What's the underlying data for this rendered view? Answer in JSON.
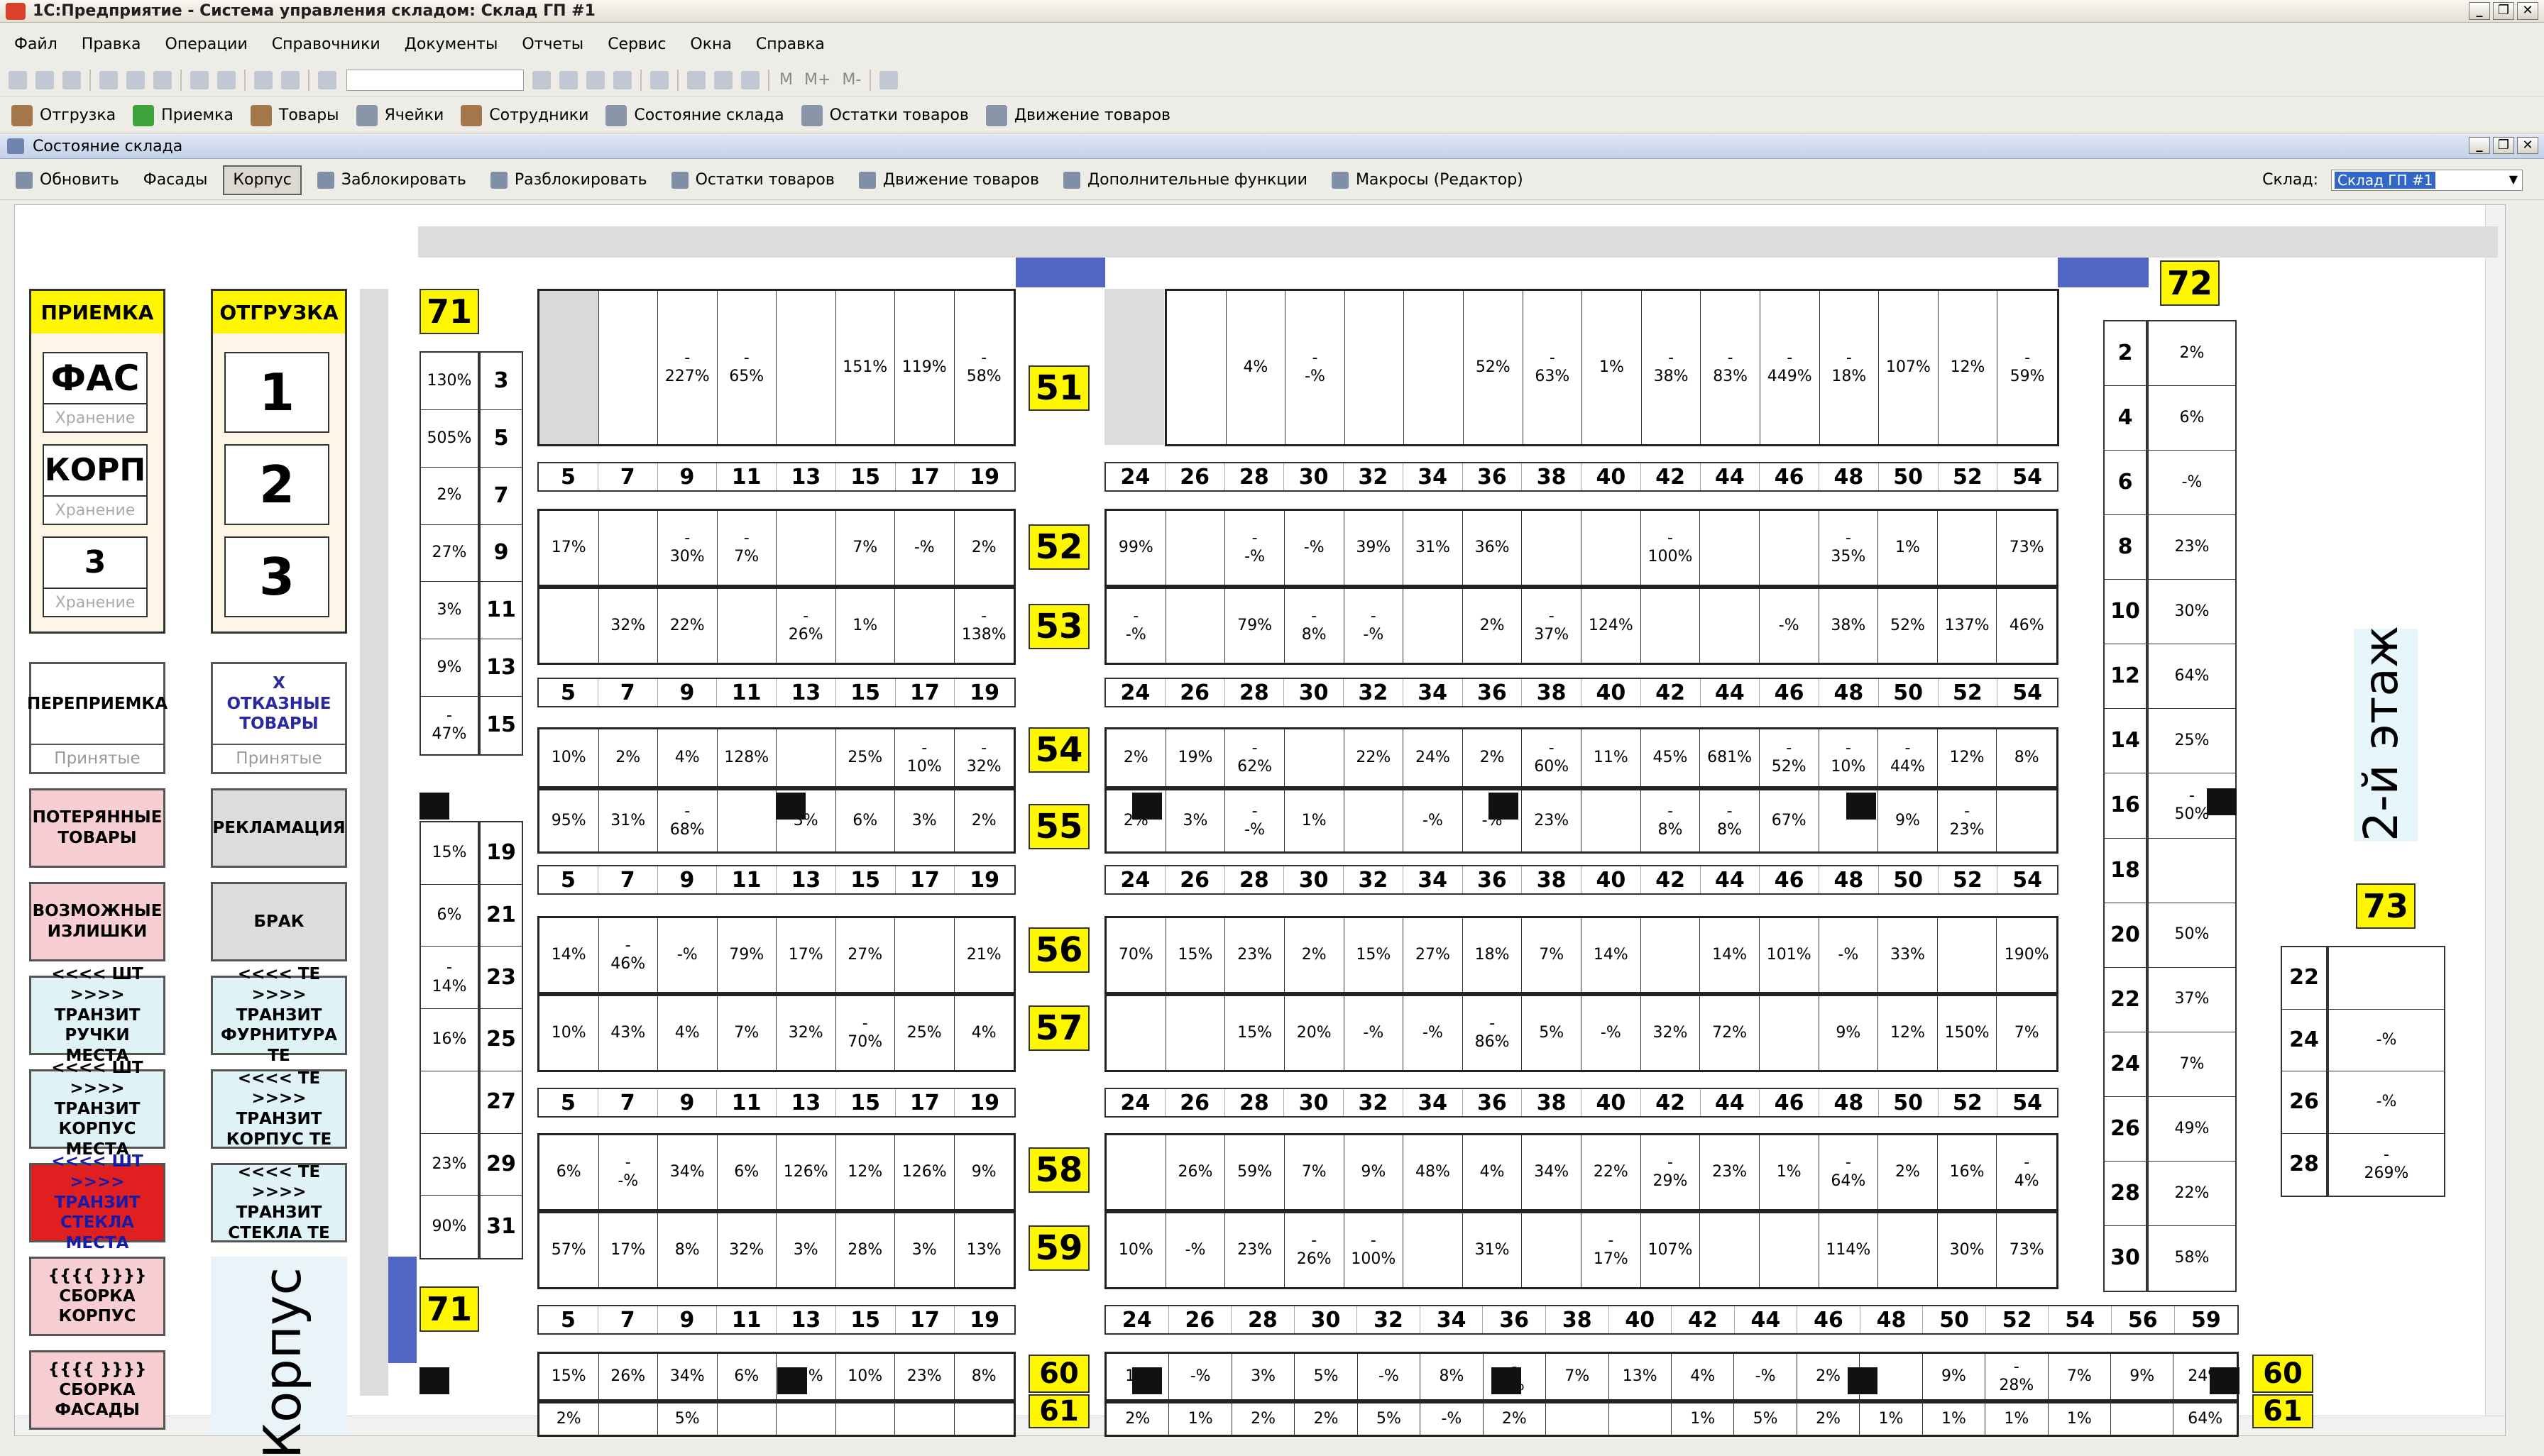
{
  "window": {
    "title": "1С:Предприятие - Система управления складом: Склад ГП #1"
  },
  "menu": [
    "Файл",
    "Правка",
    "Операции",
    "Справочники",
    "Документы",
    "Отчеты",
    "Сервис",
    "Окна",
    "Справка"
  ],
  "toolbar": {
    "m1": "M",
    "m2": "M+",
    "m3": "M-"
  },
  "shortcuts": [
    {
      "label": "Отгрузка",
      "icon": "truck-icon"
    },
    {
      "label": "Приемка",
      "icon": "checkmark-icon"
    },
    {
      "label": "Товары",
      "icon": "goods-icon"
    },
    {
      "label": "Ячейки",
      "icon": "cells-icon"
    },
    {
      "label": "Сотрудники",
      "icon": "users-icon"
    },
    {
      "label": "Состояние склада",
      "icon": "warehouse-state-icon"
    },
    {
      "label": "Остатки товаров",
      "icon": "stock-icon"
    },
    {
      "label": "Движение товаров",
      "icon": "movement-icon"
    }
  ],
  "form": {
    "title": "Состояние склада",
    "buttons": [
      {
        "label": "Обновить",
        "icon": "refresh-icon"
      },
      {
        "label": "Фасады",
        "icon": ""
      },
      {
        "label": "Корпус",
        "icon": "",
        "pressed": true
      },
      {
        "label": "Заблокировать",
        "icon": "lock-icon"
      },
      {
        "label": "Разблокировать",
        "icon": "unlock-icon"
      },
      {
        "label": "Остатки товаров",
        "icon": "stock-icon"
      },
      {
        "label": "Движение товаров",
        "icon": "movement-icon"
      },
      {
        "label": "Дополнительные функции",
        "icon": "functions-icon"
      },
      {
        "label": "Макросы (Редактор)",
        "icon": "macros-icon"
      }
    ],
    "sklad_label": "Склад:",
    "sklad_value": "Склад ГП #1"
  },
  "left": {
    "priemka": "ПРИЕМКА",
    "otgruzka": "ОТГРУЗКА",
    "fas": "ФАС",
    "korp": "КОРП",
    "three": "3",
    "storage": "Хранение",
    "g1": "1",
    "g2": "2",
    "g3": "3",
    "pereprimka": "ПЕРЕПРИЕМКА",
    "prinyatye": "Принятые",
    "otkaz": "Х\nОТКАЗНЫЕ\nТОВАРЫ",
    "poter": "ПОТЕРЯННЫЕ\nТОВАРЫ",
    "reklam": "РЕКЛАМАЦИЯ",
    "izlish": "ВОЗМОЖНЫЕ\nИЗЛИШКИ",
    "brak": "БРАК",
    "t1": "<<<< ШТ >>>>\nТРАНЗИТ\nРУЧКИ МЕСТА",
    "t2": "<<<< ТЕ >>>>\nТРАНЗИТ\nФУРНИТУРА ТЕ",
    "t3": "<<<< ШТ >>>>\nТРАНЗИТ\nКОРПУС МЕСТА",
    "t4": "<<<< ТЕ >>>>\nТРАНЗИТ\nКОРПУС ТЕ",
    "t5": "<<<< ШТ >>>>\nТРАНЗИТ\nСТЕКЛА МЕСТА",
    "t6": "<<<< ТЕ >>>>\nТРАНЗИТ\nСТЕКЛА ТЕ",
    "s1": "{{{{ }}}}\nСБОРКА\nКОРПУС",
    "s2": "{{{{ }}}}\nСБОРКА\nФАСАДЫ",
    "korpus": "Корпус"
  },
  "labels": {
    "l71": "71",
    "l72": "72",
    "l73": "73",
    "l51": "51",
    "l52": "52",
    "l53": "53",
    "l54": "54",
    "l55": "55",
    "l56": "56",
    "l57": "57",
    "l58": "58",
    "l59": "59",
    "l60": "60",
    "l61": "61",
    "l60b": "60",
    "l61b": "61",
    "l71b": "71",
    "floor2": "2-й этаж"
  },
  "nums_left": [
    "5",
    "7",
    "9",
    "11",
    "13",
    "15",
    "17",
    "19"
  ],
  "nums_right": [
    "24",
    "26",
    "28",
    "30",
    "32",
    "34",
    "36",
    "38",
    "40",
    "42",
    "44",
    "46",
    "48",
    "50",
    "52",
    "54"
  ],
  "nums_right_ext": [
    "24",
    "26",
    "28",
    "30",
    "32",
    "34",
    "36",
    "38",
    "40",
    "42",
    "44",
    "46",
    "48",
    "50",
    "52",
    "54",
    "56",
    "59"
  ],
  "col71": {
    "pct": [
      "130%",
      "505%",
      "2%",
      "27%",
      "3%",
      "9%",
      "-\n47%"
    ],
    "num": [
      "3",
      "5",
      "7",
      "9",
      "11",
      "13",
      "15"
    ],
    "pct2": [
      "15%",
      "6%",
      "-\n14%",
      "16%",
      "",
      "23%",
      "90%"
    ],
    "num2": [
      "19",
      "21",
      "23",
      "25",
      "27",
      "29",
      "31"
    ]
  },
  "col72": {
    "num": [
      "2",
      "4",
      "6",
      "8",
      "10",
      "12",
      "14",
      "16",
      "18",
      "20",
      "22",
      "24",
      "26",
      "28",
      "30"
    ],
    "pct": [
      "2%",
      "6%",
      "-%",
      "23%",
      "30%",
      "64%",
      "25%",
      "-\n50%",
      "",
      "50%",
      "37%",
      "7%",
      "49%",
      "22%",
      "58%"
    ]
  },
  "col73": {
    "num": [
      "22",
      "24",
      "26",
      "28"
    ],
    "pct": [
      "",
      "-%",
      "-%",
      "-\n269%"
    ]
  },
  "r51L": [
    "",
    "",
    "-\n227%",
    "-\n65%",
    "",
    "151%",
    "119%",
    "-\n58%"
  ],
  "r51R": [
    "",
    "4%",
    "-\n-%",
    "",
    "",
    "52%",
    "-\n63%",
    "1%",
    "-\n38%",
    "-\n83%",
    "-\n449%",
    "-\n18%",
    "107%",
    "12%",
    "-\n59%"
  ],
  "r52L": [
    "17%",
    "",
    "-\n30%",
    "-\n7%",
    "",
    "7%",
    "-%",
    "2%"
  ],
  "r52R": [
    "99%",
    "",
    "-\n-%",
    "-%",
    "39%",
    "31%",
    "36%",
    "",
    "",
    "-\n100%",
    "",
    "",
    "-\n35%",
    "1%",
    "",
    "73%"
  ],
  "r53L": [
    "",
    "32%",
    "22%",
    "",
    "-\n26%",
    "1%",
    "",
    "-\n138%"
  ],
  "r53R": [
    "-\n-%",
    "",
    "79%",
    "-\n8%",
    "-\n-%",
    "",
    "2%",
    "-\n37%",
    "124%",
    "",
    "",
    "-%",
    "38%",
    "52%",
    "137%",
    "46%"
  ],
  "r54L": [
    "10%",
    "2%",
    "4%",
    "128%",
    "",
    "25%",
    "-\n10%",
    "-\n32%"
  ],
  "r54R": [
    "2%",
    "19%",
    "-\n62%",
    "",
    "22%",
    "24%",
    "2%",
    "-\n60%",
    "11%",
    "45%",
    "681%",
    "-\n52%",
    "-\n10%",
    "-\n44%",
    "12%",
    "8%"
  ],
  "r55L": [
    "95%",
    "31%",
    "-\n68%",
    "",
    "3%",
    "6%",
    "3%",
    "2%"
  ],
  "r55R": [
    "2%",
    "3%",
    "-\n-%",
    "1%",
    "",
    "-%",
    "-%",
    "23%",
    "",
    "-\n8%",
    "-\n8%",
    "67%",
    "",
    "9%",
    "-\n23%",
    ""
  ],
  "r56L": [
    "14%",
    "-\n46%",
    "-%",
    "79%",
    "17%",
    "27%",
    "",
    "21%"
  ],
  "r56R": [
    "70%",
    "15%",
    "23%",
    "2%",
    "15%",
    "27%",
    "18%",
    "7%",
    "14%",
    "",
    "14%",
    "101%",
    "-%",
    "33%",
    "",
    "190%"
  ],
  "r57L": [
    "10%",
    "43%",
    "4%",
    "7%",
    "32%",
    "-\n70%",
    "25%",
    "4%"
  ],
  "r57R": [
    "",
    "",
    "15%",
    "20%",
    "-%",
    "-%",
    "-\n86%",
    "5%",
    "-%",
    "32%",
    "72%",
    "",
    "9%",
    "12%",
    "150%",
    "7%"
  ],
  "r58L": [
    "6%",
    "-\n-%",
    "34%",
    "6%",
    "126%",
    "12%",
    "126%",
    "9%"
  ],
  "r58R": [
    "",
    "26%",
    "59%",
    "7%",
    "9%",
    "48%",
    "4%",
    "34%",
    "22%",
    "-\n29%",
    "23%",
    "1%",
    "-\n64%",
    "2%",
    "16%",
    "-\n4%"
  ],
  "r59L": [
    "57%",
    "17%",
    "8%",
    "32%",
    "3%",
    "28%",
    "3%",
    "13%"
  ],
  "r59R": [
    "10%",
    "-%",
    "23%",
    "-\n26%",
    "-\n100%",
    "",
    "31%",
    "",
    "-\n17%",
    "107%",
    "",
    "",
    "114%",
    "",
    "30%",
    "73%"
  ],
  "r60L": [
    "15%",
    "26%",
    "34%",
    "6%",
    "11%",
    "10%",
    "23%",
    "8%"
  ],
  "r60R": [
    "1%",
    "-%",
    "3%",
    "5%",
    "-%",
    "8%",
    "-\n-%",
    "7%",
    "13%",
    "4%",
    "-%",
    "2%",
    "",
    "9%",
    "-\n28%",
    "7%",
    "9%",
    "24%"
  ],
  "r61L": [
    "2%",
    "",
    "5%",
    "",
    "",
    "",
    "",
    ""
  ],
  "r61R": [
    "2%",
    "1%",
    "2%",
    "2%",
    "5%",
    "-%",
    "2%",
    "",
    "",
    "1%",
    "5%",
    "2%",
    "1%",
    "1%",
    "1%",
    "1%",
    "",
    "64%"
  ]
}
